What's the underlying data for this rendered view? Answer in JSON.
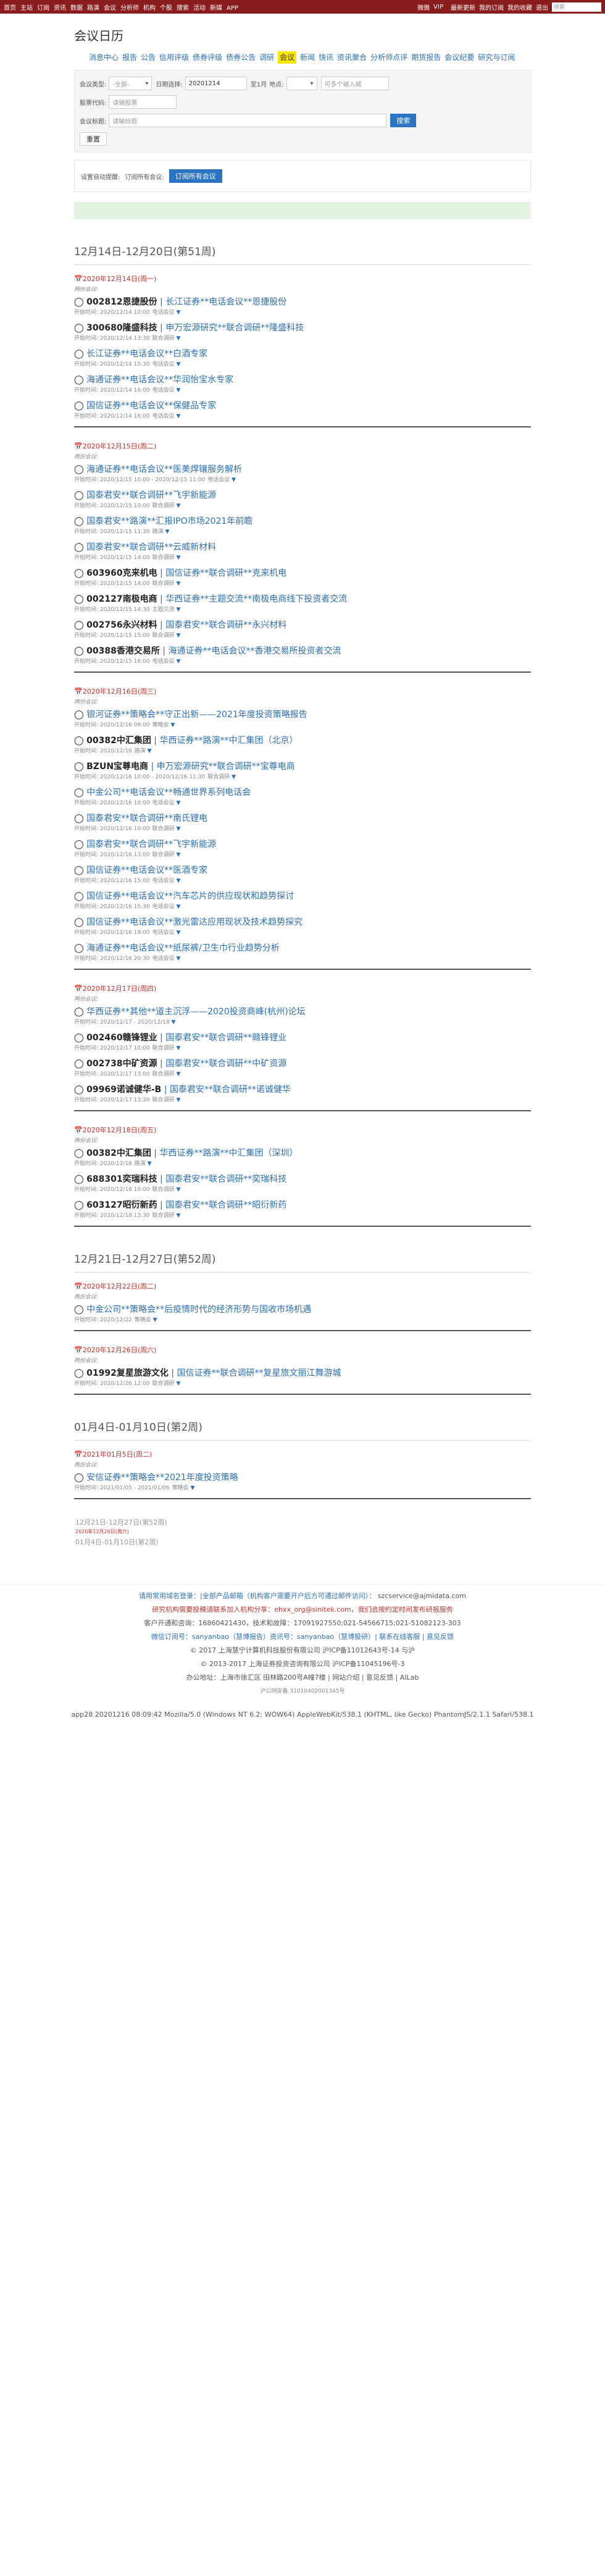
{
  "topbar": {
    "nav": [
      "首页",
      "主站",
      "订阅",
      "资讯",
      "数据",
      "路演",
      "会议",
      "分析师",
      "机构",
      "个股",
      "搜索",
      "活动",
      "新媒",
      "APP"
    ],
    "user": "微微",
    "vip": "VIP",
    "links": [
      "最新更新",
      "我的订阅",
      "我的收藏",
      "退出"
    ],
    "search_placeholder": "搜索"
  },
  "page_title": "会议日历",
  "tabs": [
    "消息中心",
    "报告",
    "公告",
    "信用评级",
    "债券评级",
    "债券公告",
    "调研",
    "会议",
    "新闻",
    "快讯",
    "资讯聚合",
    "分析师点评",
    "期货报告",
    "会议纪要",
    "研究与订阅"
  ],
  "form": {
    "type_label": "会议类型:",
    "type_value": "-全部-",
    "date_label": "日期选择:",
    "date_value": "20201214",
    "days_suffix": "至1月",
    "place_label": "地点:",
    "place_value": "",
    "place_input_placeholder": "可多个输入城",
    "stock_label": "股票代码:",
    "stock_placeholder": "请输股票",
    "kw_label": "会议标题:",
    "kw_placeholder": "请输标题",
    "search_btn": "搜索",
    "reset_btn": "重置"
  },
  "subscribe": {
    "label1": "设置自动提醒:",
    "label2": "订阅所有会议:",
    "btn": "订阅所有会议"
  },
  "weeks": [
    {
      "title": "12月14日-12月20日(第51周)",
      "days": [
        {
          "head": "2020年12月14日(周一)",
          "hint": "两份会议:",
          "events": [
            {
              "code": "002812恩捷股份",
              "title": "长江证券**电话会议**恩捷股份",
              "time": "开始时间: 2020/12/14 10:00",
              "tag": "电话会议"
            },
            {
              "code": "300680隆盛科技",
              "title": "申万宏源研究**联合调研**隆盛科技",
              "time": "开始时间: 2020/12/14 13:30",
              "tag": "联合调研"
            },
            {
              "code": "",
              "title": "长江证券**电话会议**白酒专家",
              "time": "开始时间: 2020/12/14 15:30",
              "tag": "电话会议"
            },
            {
              "code": "",
              "title": "海通证券**电话会议**华润怡宝水专家",
              "time": "开始时间: 2020/12/14 16:00",
              "tag": "电话会议"
            },
            {
              "code": "",
              "title": "国信证券**电话会议**保健品专家",
              "time": "开始时间: 2020/12/14 16:00",
              "tag": "电话会议"
            }
          ]
        },
        {
          "head": "2020年12月15日(周二)",
          "hint": "两份会议:",
          "events": [
            {
              "code": "",
              "title": "海通证券**电话会议**医美焊镶服务解析",
              "time": "开始时间: 2020/12/15 10:00 - 2020/12/15 11:00",
              "tag": "电话会议"
            },
            {
              "code": "",
              "title": "国泰君安**联合调研**飞宇新能源",
              "time": "开始时间: 2020/12/15 10:00",
              "tag": "联合调研"
            },
            {
              "code": "",
              "title": "国泰君安**路演**汇报IPO市场2021年前瞻",
              "time": "开始时间: 2020/12/15 11:30",
              "tag": "路演"
            },
            {
              "code": "",
              "title": "国泰君安**联合调研**云威新材料",
              "time": "开始时间: 2020/12/15 14:00",
              "tag": "联合调研"
            },
            {
              "code": "603960克来机电",
              "title": "国信证券**联合调研**克来机电",
              "time": "开始时间: 2020/12/15 14:00",
              "tag": "联合调研"
            },
            {
              "code": "002127南极电商",
              "title": "华西证券**主题交流**南极电商线下投资者交流",
              "time": "开始时间: 2020/12/15 14:30",
              "tag": "主题交流"
            },
            {
              "code": "002756永兴材料",
              "title": "国泰君安**联合调研**永兴材料",
              "time": "开始时间: 2020/12/15 15:00",
              "tag": "联合调研"
            },
            {
              "code": "00388香港交易所",
              "title": "海通证券**电话会议**香港交易所投资者交流",
              "time": "开始时间: 2020/12/15 16:00",
              "tag": "电话会议"
            }
          ]
        },
        {
          "head": "2020年12月16日(周三)",
          "hint": "两份会议:",
          "events": [
            {
              "code": "",
              "title": "银河证券**策略会**守正出新——2021年度投资策略报告",
              "time": "开始时间: 2020/12/16 09:00",
              "tag": "策略会"
            },
            {
              "code": "00382中汇集团",
              "title": "华西证券**路演**中汇集团（北京）",
              "time": "开始时间: 2020/12/16",
              "tag": "路演"
            },
            {
              "code": "BZUN宝尊电商",
              "title": "申万宏源研究**联合调研**宝尊电商",
              "time": "开始时间: 2020/12/16 10:00 - 2020/12/16 11:30",
              "tag": "联合调研"
            },
            {
              "code": "",
              "title": "中金公司**电话会议**畅通世界系列电话会",
              "time": "开始时间: 2020/12/16 10:00",
              "tag": "电话会议"
            },
            {
              "code": "",
              "title": "国泰君安**联合调研**南氏锂电",
              "time": "开始时间: 2020/12/16 10:00",
              "tag": "联合调研"
            },
            {
              "code": "",
              "title": "国泰君安**联合调研**飞宇新能源",
              "time": "开始时间: 2020/12/16 13:00",
              "tag": "联合调研"
            },
            {
              "code": "",
              "title": "国信证券**电话会议**医酒专家",
              "time": "开始时间: 2020/12/16 15:00",
              "tag": "电话会议"
            },
            {
              "code": "",
              "title": "国信证券**电话会议**汽车芯片的供应现状和趋势探讨",
              "time": "开始时间: 2020/12/16 15:30",
              "tag": "电话会议"
            },
            {
              "code": "",
              "title": "国信证券**电话会议**激光雷达应用现状及技术趋势探究",
              "time": "开始时间: 2020/12/16 19:00",
              "tag": "电话会议"
            },
            {
              "code": "",
              "title": "海通证券**电话会议**纸尿裤/卫生巾行业趋势分析",
              "time": "开始时间: 2020/12/16 20:30",
              "tag": "电话会议"
            }
          ]
        },
        {
          "head": "2020年12月17日(周四)",
          "hint": "两份会议:",
          "events": [
            {
              "code": "",
              "title": "华西证券**其他**道主沉浮——2020投资商峰(杭州)论坛",
              "time": "开始时间: 2020/12/17 - 2020/12/18",
              "tag": ""
            },
            {
              "code": "002460赣锋锂业",
              "title": "国泰君安**联合调研**赣锋锂业",
              "time": "开始时间: 2020/12/17 10:00",
              "tag": "联合调研"
            },
            {
              "code": "002738中矿资源",
              "title": "国泰君安**联合调研**中矿资源",
              "time": "开始时间: 2020/12/17 13:00",
              "tag": "联合调研"
            },
            {
              "code": "09969诺诚健华-B",
              "title": "国泰君安**联合调研**诺诚健华",
              "time": "开始时间: 2020/12/17 13:30",
              "tag": "联合调研"
            }
          ]
        },
        {
          "head": "2020年12月18日(周五)",
          "hint": "两份会议:",
          "events": [
            {
              "code": "00382中汇集团",
              "title": "华西证券**路演**中汇集团（深圳）",
              "time": "开始时间: 2020/12/18",
              "tag": "路演"
            },
            {
              "code": "688301奕瑞科技",
              "title": "国泰君安**联合调研**奕瑞科技",
              "time": "开始时间: 2020/12/18 10:00",
              "tag": "联合调研"
            },
            {
              "code": "603127昭衍新药",
              "title": "国泰君安**联合调研**昭衍新药",
              "time": "开始时间: 2020/12/18 13:30",
              "tag": "联合调研"
            }
          ]
        }
      ]
    },
    {
      "title": "12月21日-12月27日(第52周)",
      "days": [
        {
          "head": "2020年12月22日(周二)",
          "hint": "两份会议:",
          "events": [
            {
              "code": "",
              "title": "中金公司**策略会**后疫情时代的经济形势与国收市场机遇",
              "time": "开始时间: 2020/12/22",
              "tag": "策略会"
            }
          ]
        },
        {
          "head": "2020年12月26日(周六)",
          "hint": "两份会议:",
          "events": [
            {
              "code": "01992复星旅游文化",
              "title": "国信证券**联合调研**复星旅文丽江舞游城",
              "time": "开始时间: 2020/12/26 12:00",
              "tag": "联合调研"
            }
          ]
        }
      ]
    },
    {
      "title": "01月4日-01月10日(第2周)",
      "days": [
        {
          "head": "2021年01月5日(周二)",
          "hint": "两份会议:",
          "events": [
            {
              "code": "",
              "title": "安信证券**策略会**2021年度投资策略",
              "time": "开始时间: 2021/01/05 - 2021/01/06",
              "tag": "策略会"
            }
          ]
        }
      ]
    }
  ],
  "mini": {
    "line1": "12月21日-12月27日(第52周)",
    "line2": "2020年12月26日(周六)",
    "line3": "01月4日-01月10日(第2周)"
  },
  "footer": {
    "l1": "请用常用域名登录：|全部产品邮箱（机构客户需要开户后方可通过邮件访问）：",
    "l1b": "szcservice@ajmidata.com",
    "l2": "研究机构需要投稿请联系加入机构分享：ehxx_org@sinitek.com，我们会按约定时间发布研报服务",
    "l3": "客户开通和咨询：16860421430，技术和故障：17091927550;021-54566715;021-51082123-303",
    "l4": "微信订阅号：sanyanbao（慧博报告）资讯号：sanyanbao（慧博投研）| 联系在线客服 | 意见反馈",
    "l5": "© 2017 上海慧宁计算机科技股份有限公司 沪ICP备11012643号-14 与沪",
    "l6": "© 2013-2017 上海证券投资咨询有限公司 沪ICP备11045196号-3",
    "l7": "办公地址：上海市徐汇区 田林路200号A幢7楼 | 网站介绍 | 意见反馈 | AILab",
    "l8": "沪公网安备 31010402001345号"
  },
  "ua": "app28 20201216 08:09:42 Mozilla/5.0 (Windows NT 6.2; WOW64) AppleWebKit/538.1 (KHTML, like Gecko) PhantomJS/2.1.1 Safari/538.1"
}
